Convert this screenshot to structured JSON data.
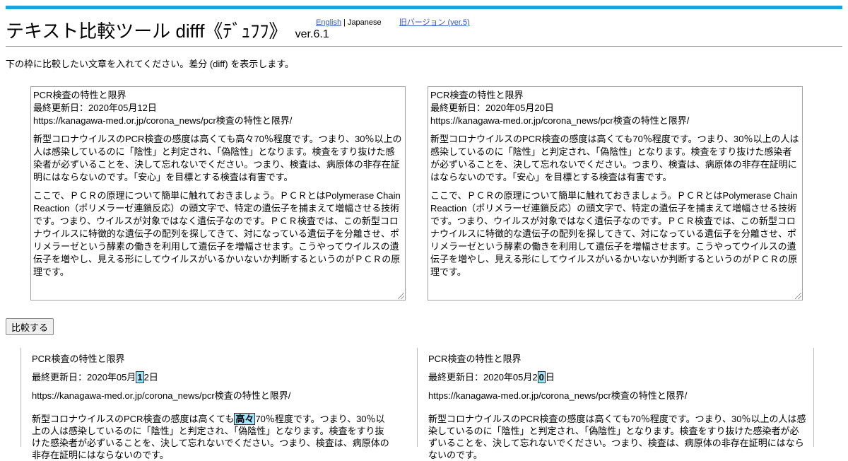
{
  "header": {
    "title": "テキスト比較ツール difff《ﾃﾞｭﾌﾌ》",
    "version": "ver.6.1",
    "lang_english": "English",
    "lang_separator": "|",
    "lang_japanese": "Japanese",
    "old_version_link": "旧バージョン (ver.5)"
  },
  "intro": "下の枠に比較したい文章を入れてください。差分 (diff) を表示します。",
  "input_left": {
    "line1": "PCR検査の特性と限界",
    "line2": "最終更新日：2020年05月12日",
    "line3": "https://kanagawa-med.or.jp/corona_news/pcr検査の特性と限界/",
    "para1": "新型コロナウイルスのPCR検査の感度は高くても高々70％程度です。つまり、30％以上の人は感染しているのに「陰性」と判定され、「偽陰性」となります。検査をすり抜けた感染者が必ずいることを、決して忘れないでください。つまり、検査は、病原体の非存在証明にはならないのです。「安心」を目標とする検査は有害です。",
    "para2": "ここで、ＰＣＲの原理について簡単に触れておきましょう。ＰＣＲとはPolymerase Chain Reaction（ポリメラーゼ連鎖反応）の頭文字で、特定の遺伝子を捕まえて増幅させる技術です。つまり、ウイルスが対象ではなく遺伝子なのです。ＰＣＲ検査では、この新型コロナウイルスに特徴的な遺伝子の配列を探してきて、対になっている遺伝子を分離させ、ポリメラーゼという酵素の働きを利用して遺伝子を増幅させます。こうやってウイルスの遺伝子を増やし、見える形にしてウイルスがいるかいないか判断するというのがＰＣＲの原理です。"
  },
  "input_right": {
    "line1": "PCR検査の特性と限界",
    "line2": "最終更新日：2020年05月20日",
    "line3": "https://kanagawa-med.or.jp/corona_news/pcr検査の特性と限界/",
    "para1": "新型コロナウイルスのPCR検査の感度は高くても70％程度です。つまり、30％以上の人は感染しているのに「陰性」と判定され、「偽陰性」となります。検査をすり抜けた感染者が必ずいることを、決して忘れないでください。つまり、検査は、病原体の非存在証明にはならないのです。「安心」を目標とする検査は有害です。",
    "para2": "ここで、ＰＣＲの原理について簡単に触れておきましょう。ＰＣＲとはPolymerase Chain Reaction（ポリメラーゼ連鎖反応）の頭文字で、特定の遺伝子を捕まえて増幅させる技術です。つまり、ウイルスが対象ではなく遺伝子なのです。ＰＣＲ検査では、この新型コロナウイルスに特徴的な遺伝子の配列を探してきて、対になっている遺伝子を分離させ、ポリメラーゼという酵素の働きを利用して遺伝子を増幅させます。こうやってウイルスの遺伝子を増やし、見える形にしてウイルスがいるかいないか判断するというのがＰＣＲの原理です。"
  },
  "compare_button": "比較する",
  "result_left": {
    "line1": "PCR検査の特性と限界",
    "line2_pre": "最終更新日：2020年05月",
    "line2_diff": "1",
    "line2_post": "2日",
    "line3": "https://kanagawa-med.or.jp/corona_news/pcr検査の特性と限界/",
    "line4_pre": "新型コロナウイルスのPCR検査の感度は高くても",
    "line4_diff": "高々",
    "line4_post": "70％程度です。つまり、30％以上の人は感染しているのに「陰性」と判定され、「偽陰性」となります。検査をすり抜けた感染者が必ずいることを、決して忘れないでください。つまり、検査は、病原体の非存在証明にはならないのです。"
  },
  "result_right": {
    "line1": "PCR検査の特性と限界",
    "line2_pre": "最終更新日：2020年05月2",
    "line2_diff": "0",
    "line2_post": "日",
    "line3": "https://kanagawa-med.or.jp/corona_news/pcr検査の特性と限界/",
    "line4": "新型コロナウイルスのPCR検査の感度は高くても70％程度です。つまり、30％以上の人は感染しているのに「陰性」と判定され、「偽陰性」となります。検査をすり抜けた感染者が必ずいることを、決して忘れないでください。つまり、検査は、病原体の非存在証明にはならないのです。"
  },
  "colors": {
    "accent": "#1aa3dd",
    "diff_highlight": "#9ee7ff",
    "link": "#3355cc"
  }
}
